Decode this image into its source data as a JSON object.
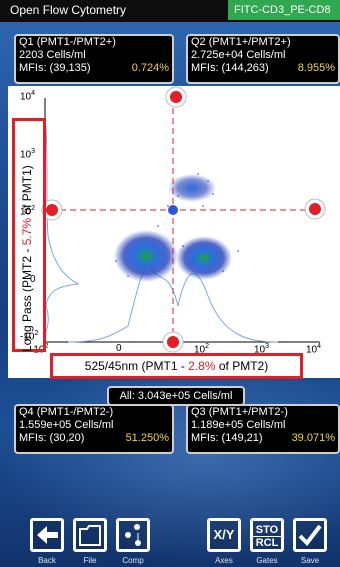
{
  "app_title": "Open Flow Cytometry",
  "dataset": "FITC-CD3_PE-CD8",
  "quadrants": {
    "q1": {
      "name": "Q1 (PMT1-/PMT2+)",
      "cells": "2203 Cells/ml",
      "mfi": "MFIs: (39,135)",
      "pct": "0.724%"
    },
    "q2": {
      "name": "Q2 (PMT1+/PMT2+)",
      "cells": "2.725e+04 Cells/ml",
      "mfi": "MFIs: (144,263)",
      "pct": "8.955%"
    },
    "q4": {
      "name": "Q4 (PMT1-/PMT2-)",
      "cells": "1.559e+05 Cells/ml",
      "mfi": "MFIs: (30,20)",
      "pct": "51.250%"
    },
    "q3": {
      "name": "Q3 (PMT1+/PMT2-)",
      "cells": "1.189e+05 Cells/ml",
      "mfi": "MFIs: (149,21)",
      "pct": "39.071%"
    }
  },
  "all_cells": "All: 3.043e+05 Cells/ml",
  "plot": {
    "ylabel_pre": "Long Pass (PMT2 - ",
    "ylabel_pct": "5.7%",
    "ylabel_post": " of PMT1)",
    "xlabel_pre": "525/45nm (PMT1 - ",
    "xlabel_pct": "2.8%",
    "xlabel_post": " of PMT2)",
    "y_ticks": [
      "10^4",
      "10^3",
      "10^2",
      "0",
      "-10^2"
    ],
    "x_ticks": [
      "-10^2",
      "0",
      "10^2",
      "10^3",
      "10^4"
    ]
  },
  "toolbar": {
    "back": "Back",
    "file": "File",
    "comp": "Comp",
    "axes_icon": "X/Y",
    "axes": "Axes",
    "gates_icon_top": "STO",
    "gates_icon_bottom": "RCL",
    "gates": "Gates",
    "save": "Save"
  },
  "colors": {
    "accent_red": "#e31e24",
    "pct_yellow": "#f2d33c",
    "dataset_green": "#2fa84f",
    "gate_blue": "#2f55e0"
  }
}
